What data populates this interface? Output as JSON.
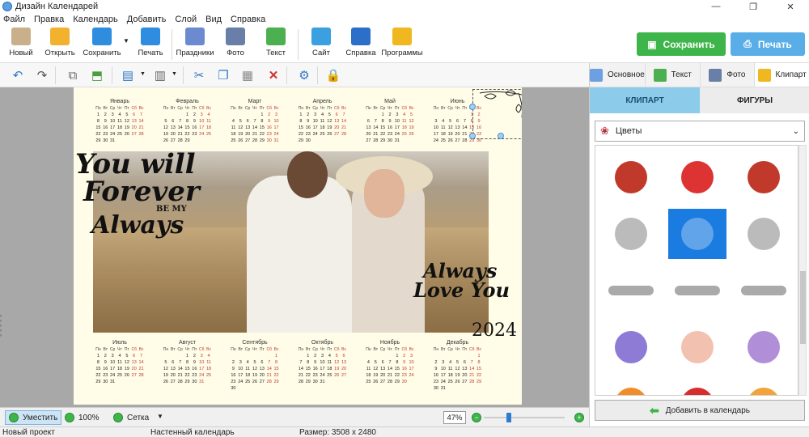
{
  "window": {
    "title": "Дизайн Календарей",
    "min": "—",
    "max": "❐",
    "close": "✕"
  },
  "menu": [
    "Файл",
    "Правка",
    "Календарь",
    "Добавить",
    "Слой",
    "Вид",
    "Справка"
  ],
  "toolbar": {
    "buttons": [
      {
        "label": "Новый",
        "color": "#c9b08a"
      },
      {
        "label": "Открыть",
        "color": "#f2b230"
      },
      {
        "label": "Сохранить",
        "color": "#2f8de0"
      },
      {
        "label": "Печать",
        "color": "#2f8de0"
      },
      {
        "label": "Праздники",
        "color": "#6c8ad0"
      },
      {
        "label": "Фото",
        "color": "#6a7fa8"
      },
      {
        "label": "Текст",
        "color": "#4caf50"
      },
      {
        "label": "Сайт",
        "color": "#3aa0e0"
      },
      {
        "label": "Справка",
        "color": "#2b6fc8"
      },
      {
        "label": "Программы",
        "color": "#f0b820"
      }
    ],
    "save_label": "Сохранить",
    "print_label": "Печать",
    "save_color": "#3eb54a",
    "print_color": "#5aaee8"
  },
  "edit_toolbar": [
    "undo-icon",
    "redo-icon",
    "layer-back-icon",
    "layer-front-icon",
    "align-icon",
    "distribute-icon",
    "cut-icon",
    "copy-icon",
    "paste-icon",
    "delete-icon",
    "properties-icon",
    "lock-icon"
  ],
  "calendar": {
    "weekdays": [
      "Пн",
      "Вт",
      "Ср",
      "Чт",
      "Пт",
      "Сб",
      "Вс"
    ],
    "top_months": [
      {
        "name": "Январь",
        "offset": 0,
        "days": 31
      },
      {
        "name": "Февраль",
        "offset": 3,
        "days": 29
      },
      {
        "name": "Март",
        "offset": 4,
        "days": 31
      },
      {
        "name": "Апрель",
        "offset": 0,
        "days": 30
      },
      {
        "name": "Май",
        "offset": 2,
        "days": 31
      },
      {
        "name": "Июнь",
        "offset": 5,
        "days": 30
      }
    ],
    "bottom_months": [
      {
        "name": "Июль",
        "offset": 0,
        "days": 31
      },
      {
        "name": "Август",
        "offset": 3,
        "days": 31
      },
      {
        "name": "Сентябрь",
        "offset": 6,
        "days": 30
      },
      {
        "name": "Октябрь",
        "offset": 1,
        "days": 31
      },
      {
        "name": "Ноябрь",
        "offset": 4,
        "days": 30
      },
      {
        "name": "Декабрь",
        "offset": 6,
        "days": 31
      }
    ],
    "weekend_color": "#c0392b",
    "background": "#fffce8"
  },
  "texts": {
    "script1_lines": [
      "You will",
      "Forever",
      "BE MY",
      "Always"
    ],
    "script2_lines": [
      "Always",
      "Love You"
    ],
    "year": "2024"
  },
  "statusbar": {
    "fit_label": "Уместить",
    "zoom100_label": "100%",
    "grid_label": "Сетка",
    "zoom_value": "47%",
    "zoom_fraction": 0.47
  },
  "info": {
    "project": "Новый проект",
    "type": "Настенный календарь",
    "size": "Размер: 3508 x 2480"
  },
  "panel": {
    "tabs": [
      {
        "label": "Основное",
        "color": "#6ca0e0"
      },
      {
        "label": "Текст",
        "color": "#4caf50"
      },
      {
        "label": "Фото",
        "color": "#6a7fa8"
      },
      {
        "label": "Клипарт",
        "color": "#f0b820"
      }
    ],
    "subtabs": [
      "КЛИПАРТ",
      "ФИГУРЫ"
    ],
    "category": "Цветы",
    "add_label": "Добавить в календарь",
    "clipart_colors": [
      "#c0392b",
      "#d33",
      "#c0392b",
      "#bbb",
      "#e8f0f8",
      "#bbb",
      "#aaa",
      "#aaa",
      "#aaa",
      "#8e7bd6",
      "#f3c1b0",
      "#b08ed8",
      "#f28c28",
      "#d62d2d",
      "#f2a33a"
    ]
  }
}
